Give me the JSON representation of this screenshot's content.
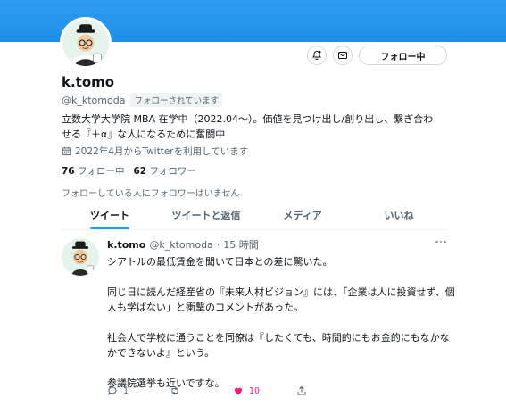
{
  "profile": {
    "name": "k.tomo",
    "handle": "@k_ktomoda",
    "follows_you": "フォローされています",
    "bio_line1": "立数大学大学院 MBA 在学中（2022.04～）。価値を見つけ出し/創り出し、繋ぎ合わ",
    "bio_line2": "せる『＋α』な人になるために奮闘中",
    "joined": "2022年4月からTwitterを利用しています",
    "following_count": "76",
    "following_label": "フォロー中",
    "followers_count": "62",
    "followers_label": "フォロワー",
    "mutual_note": "フォローしている人にフォロワーはいません"
  },
  "actions": {
    "follow_label": "フォロー中",
    "bell_icon": "bell-plus-icon",
    "mail_icon": "mail-icon"
  },
  "tabs": [
    {
      "label": "ツイート"
    },
    {
      "label": "ツイートと返信"
    },
    {
      "label": "メディア"
    },
    {
      "label": "いいね"
    }
  ],
  "tweet": {
    "name": "k.tomo",
    "handle": "@k_ktomoda",
    "separator": "·",
    "time": "15 時間",
    "paragraphs": [
      "シアトルの最低賃金を聞いて日本との差に驚いた。",
      "同じ日に読んだ経産省の『未来人材ビジョン』には、「企業は人に投資せず、個人も学ばない」と衝撃のコメントがあった。",
      "社会人で学校に通うことを同僚は『したくても、時間的にもお金的にもなかなかできないよ』という。",
      "参議院選挙も近いですな。"
    ],
    "reply_count": "1",
    "retweet_count": "",
    "like_count": "10"
  },
  "colors": {
    "banner": "#1d8fe8",
    "accent": "#1d9bf0",
    "like": "#f91880",
    "secondary_text": "#536471"
  }
}
